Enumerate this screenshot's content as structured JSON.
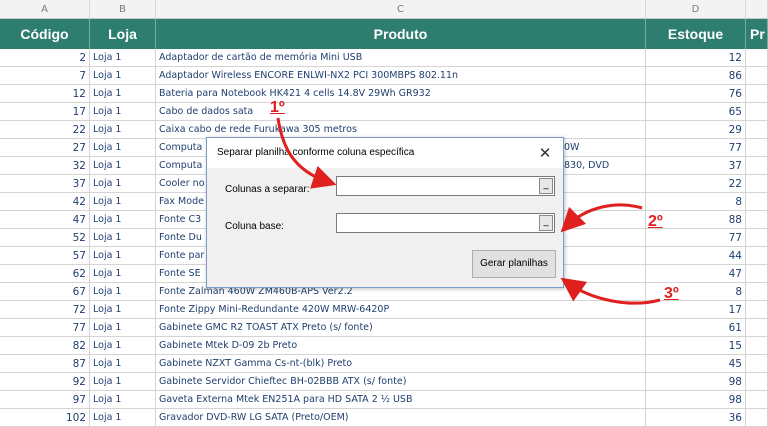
{
  "columns": {
    "a": "A",
    "b": "B",
    "c": "C",
    "d": "D",
    "e": ""
  },
  "headers": {
    "codigo": "Código",
    "loja": "Loja",
    "produto": "Produto",
    "estoque": "Estoque",
    "extra": "Pr"
  },
  "rows": [
    {
      "codigo": "2",
      "loja": "Loja 1",
      "produto": "Adaptador de cartão de memória Mini USB",
      "estoque": "12"
    },
    {
      "codigo": "7",
      "loja": "Loja 1",
      "produto": "Adaptador Wireless ENCORE ENLWI-NX2 PCI 300MBPS 802.11n",
      "estoque": "86"
    },
    {
      "codigo": "12",
      "loja": "Loja 1",
      "produto": "Bateria para Notebook HK421 4 cells 14.8V 29Wh GR932",
      "estoque": "76"
    },
    {
      "codigo": "17",
      "loja": "Loja 1",
      "produto": "Cabo de dados sata",
      "estoque": "65"
    },
    {
      "codigo": "22",
      "loja": "Loja 1",
      "produto": "Caixa cabo de rede Furukawa 305 metros",
      "estoque": "29"
    },
    {
      "codigo": "27",
      "loja": "Loja 1",
      "produto": "Computa",
      "right": "0W",
      "estoque": "77"
    },
    {
      "codigo": "32",
      "loja": "Loja 1",
      "produto": "Computa",
      "right": "830, DVD",
      "estoque": "37"
    },
    {
      "codigo": "37",
      "loja": "Loja 1",
      "produto": "Cooler no",
      "estoque": "22"
    },
    {
      "codigo": "42",
      "loja": "Loja 1",
      "produto": "Fax Mode",
      "estoque": "8"
    },
    {
      "codigo": "47",
      "loja": "Loja 1",
      "produto": "Fonte C3",
      "estoque": "88"
    },
    {
      "codigo": "52",
      "loja": "Loja 1",
      "produto": "Fonte Du",
      "estoque": "77"
    },
    {
      "codigo": "57",
      "loja": "Loja 1",
      "produto": "Fonte par",
      "estoque": "44"
    },
    {
      "codigo": "62",
      "loja": "Loja 1",
      "produto": "Fonte SE",
      "estoque": "47"
    },
    {
      "codigo": "67",
      "loja": "Loja 1",
      "produto": "Fonte Zalman 460W ZM460B-APS Ver2.2",
      "estoque": "8"
    },
    {
      "codigo": "72",
      "loja": "Loja 1",
      "produto": "Fonte Zippy Mini-Redundante 420W MRW-6420P",
      "estoque": "17"
    },
    {
      "codigo": "77",
      "loja": "Loja 1",
      "produto": "Gabinete GMC R2 TOAST ATX Preto (s/ fonte)",
      "estoque": "61"
    },
    {
      "codigo": "82",
      "loja": "Loja 1",
      "produto": "Gabinete Mtek D-09 2b Preto",
      "estoque": "15"
    },
    {
      "codigo": "87",
      "loja": "Loja 1",
      "produto": "Gabinete NZXT Gamma Cs-nt-(blk) Preto",
      "estoque": "45"
    },
    {
      "codigo": "92",
      "loja": "Loja 1",
      "produto": "Gabinete Servidor Chieftec BH-02BBB ATX (s/ fonte)",
      "estoque": "98"
    },
    {
      "codigo": "97",
      "loja": "Loja 1",
      "produto": "Gaveta Externa Mtek EN251A para HD SATA 2 ½ USB",
      "estoque": "98"
    },
    {
      "codigo": "102",
      "loja": "Loja 1",
      "produto": "Gravador DVD-RW LG SATA (Preto/OEM)",
      "estoque": "36"
    }
  ],
  "dialog": {
    "title": "Separar planilha conforme coluna específica",
    "close_glyph": "✕",
    "label_colunas": "Colunas a separar:",
    "label_base": "Coluna base:",
    "ref_button_glyph": "_",
    "button_label": "Gerar planilhas"
  },
  "annotations": {
    "one": "1º",
    "two": "2º",
    "three": "3º"
  },
  "colors": {
    "header_bg": "#2e7e6f",
    "cell_text": "#1f3f6f",
    "annotation": "#e01f1f"
  }
}
